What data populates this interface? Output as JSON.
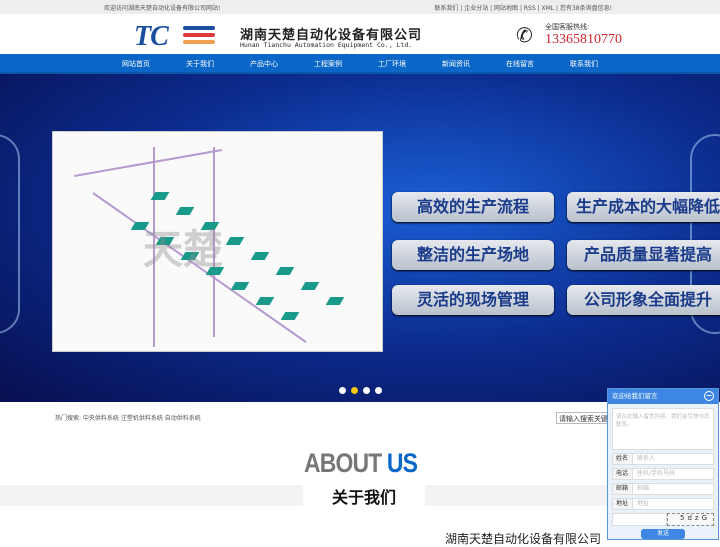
{
  "topbar": {
    "welcome": "欢迎访问湖南天楚自动化设备有限公司网站!",
    "links": "联系我们 | 企业分站 | 网站地图 | RSS | XML | 您有38条询盘信息!"
  },
  "header": {
    "logo_text": "TC",
    "company_cn": "湖南天楚自动化设备有限公司",
    "company_en": "Hunan Tianchu Automation Equipment Co., Ltd.",
    "hotline_label": "全国客服热线:",
    "hotline": "13365810770"
  },
  "nav": [
    "网站首页",
    "关于我们",
    "产品中心",
    "工程案例",
    "工厂环境",
    "新闻资讯",
    "在线留言",
    "联系我们"
  ],
  "banner": {
    "watermark": "天楚",
    "tags": [
      "高效的生产流程",
      "生产成本的大幅降低",
      "整洁的生产场地",
      "产品质量显著提高",
      "灵活的现场管理",
      "公司形象全面提升"
    ],
    "slides": 4,
    "active_slide": 1
  },
  "search": {
    "hot": "热门搜索: 中央供料系统 注塑机供料系统 自动供料系统",
    "placeholder": "请输入搜索关键词"
  },
  "about": {
    "en_a": "ABOUT ",
    "en_b": "US",
    "cn": "关于我们",
    "company": "湖南天楚自动化设备有限公司"
  },
  "chat": {
    "title": "欢迎给我们留言",
    "message_placeholder": "请在此输入留言内容，我们会尽快与您联系。",
    "fields": [
      {
        "k": "姓名",
        "v": "联系人"
      },
      {
        "k": "电话",
        "v": "座机/手机号码"
      },
      {
        "k": "邮箱",
        "v": "邮箱"
      },
      {
        "k": "地址",
        "v": "地址"
      }
    ],
    "captcha": "5dzG",
    "send": "发送"
  },
  "colors": {
    "brand": "#0b67c7",
    "hotline": "#d0282e",
    "accent_dot": "#f3c70b"
  }
}
